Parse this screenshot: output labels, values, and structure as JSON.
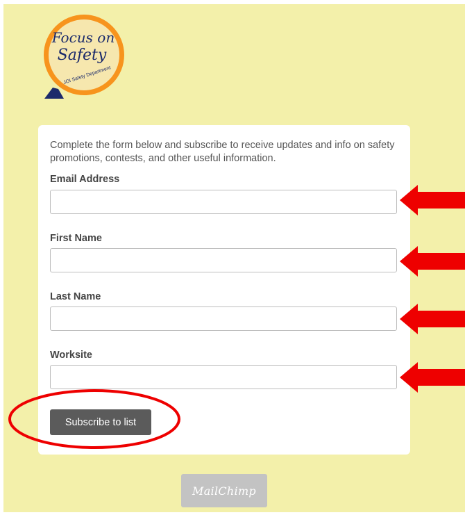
{
  "logo": {
    "line1": "Focus on",
    "line2": "Safety",
    "subline": "JOI Safety Department"
  },
  "form": {
    "intro": "Complete the form below and subscribe to receive updates and info on safety promotions, contests, and other useful information.",
    "fields": [
      {
        "label": "Email Address",
        "value": "",
        "placeholder": ""
      },
      {
        "label": "First Name",
        "value": "",
        "placeholder": ""
      },
      {
        "label": "Last Name",
        "value": "",
        "placeholder": ""
      },
      {
        "label": "Worksite",
        "value": "",
        "placeholder": ""
      }
    ],
    "submit_label": "Subscribe to list"
  },
  "footer": {
    "badge_label": "MailChimp"
  },
  "colors": {
    "page_background": "#f3f0aa",
    "card_background": "#ffffff",
    "button_background": "#5b5b5b",
    "annotation_red": "#ee0000",
    "logo_orange": "#f7941d",
    "logo_navy": "#1b2a6b"
  },
  "annotations": {
    "arrow_icon": "red-left-arrow",
    "ring_icon": "red-ellipse"
  }
}
